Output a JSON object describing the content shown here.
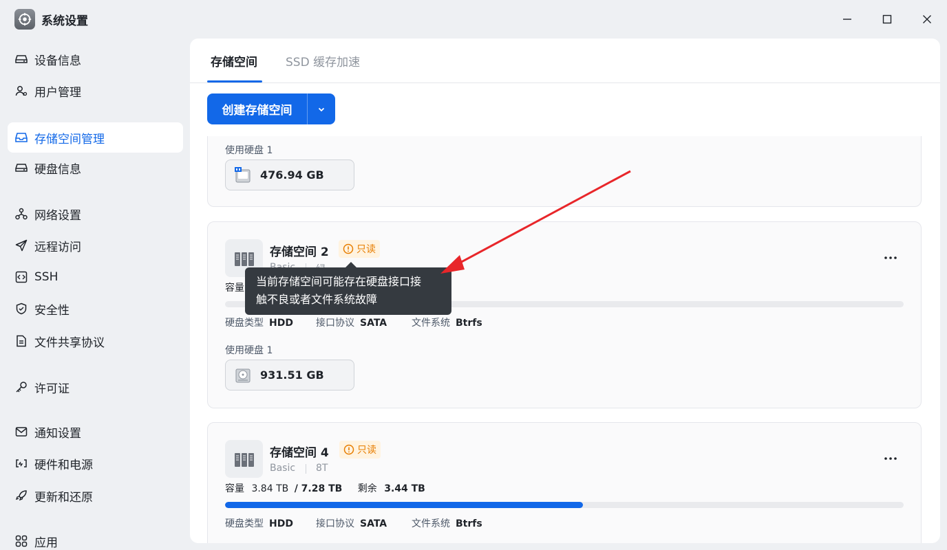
{
  "window": {
    "title": "系统设置",
    "app_icon": "settings-gear-icon",
    "controls": [
      "minimize-icon",
      "maximize-icon",
      "close-icon"
    ]
  },
  "sidebar": {
    "items": [
      {
        "label": "设备信息",
        "icon": "drive-icon"
      },
      {
        "label": "用户管理",
        "icon": "user-icon"
      },
      {
        "label": "存储空间管理",
        "icon": "inbox-icon",
        "active": true
      },
      {
        "label": "硬盘信息",
        "icon": "drive-icon"
      },
      {
        "label": "网络设置",
        "icon": "network-icon"
      },
      {
        "label": "远程访问",
        "icon": "send-icon"
      },
      {
        "label": "SSH",
        "icon": "code-icon"
      },
      {
        "label": "安全性",
        "icon": "shield-icon"
      },
      {
        "label": "文件共享协议",
        "icon": "file-icon"
      },
      {
        "label": "许可证",
        "icon": "key-icon"
      },
      {
        "label": "通知设置",
        "icon": "mail-icon"
      },
      {
        "label": "硬件和电源",
        "icon": "plug-icon"
      },
      {
        "label": "更新和还原",
        "icon": "rocket-icon"
      },
      {
        "label": "应用",
        "icon": "apps-icon"
      }
    ]
  },
  "tabs": [
    {
      "label": "存储空间",
      "active": true
    },
    {
      "label": "SSD 缓存加速",
      "active": false
    }
  ],
  "toolbar": {
    "create_label": "创建存储空间"
  },
  "card1": {
    "disks_label": "使用硬盘 1",
    "disk_size": "476.94 GB"
  },
  "card2": {
    "name": "存储空间 2",
    "badge": "只读",
    "meta_type": "Basic",
    "meta_partial": "绿",
    "capacity_label": "容量",
    "fill_fraction": 0.0,
    "disk_type_label": "硬盘类型",
    "disk_type": "HDD",
    "interface_label": "接口协议",
    "interface": "SATA",
    "fs_label": "文件系统",
    "fs": "Btrfs",
    "disks_label": "使用硬盘 1",
    "disk_size": "931.51 GB"
  },
  "card3": {
    "name": "存储空间 4",
    "badge": "只读",
    "meta_type": "Basic",
    "meta_size": "8T",
    "capacity_label": "容量",
    "used": "3.84 TB",
    "total": "/ 7.28 TB",
    "remaining_label": "剩余",
    "remaining": "3.44 TB",
    "fill_fraction": 0.527,
    "disk_type_label": "硬盘类型",
    "disk_type": "HDD",
    "interface_label": "接口协议",
    "interface": "SATA",
    "fs_label": "文件系统",
    "fs": "Btrfs"
  },
  "tooltip": {
    "line1": "当前存储空间可能存在硬盘接口接",
    "line2": "触不良或者文件系统故障"
  },
  "colors": {
    "accent": "#1268e8",
    "warning": "#e77d00",
    "annotation": "#e8262a"
  }
}
